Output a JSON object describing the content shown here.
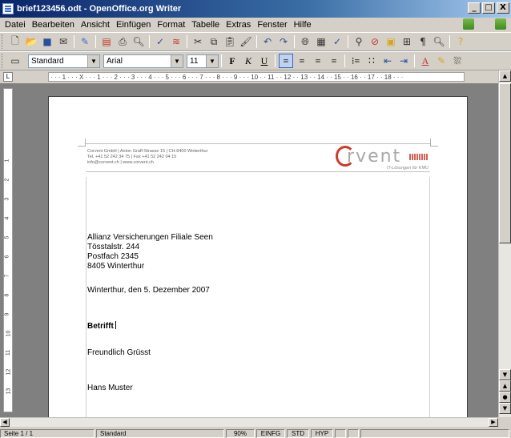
{
  "window": {
    "title": "brief123456.odt - OpenOffice.org Writer",
    "buttons": [
      "_",
      "□",
      "X"
    ]
  },
  "menu": [
    "Datei",
    "Bearbeiten",
    "Ansicht",
    "Einfügen",
    "Format",
    "Tabelle",
    "Extras",
    "Fenster",
    "Hilfe"
  ],
  "toolbar": {
    "paragraph_style": "Standard",
    "font_name": "Arial",
    "font_size": "11",
    "bold_label": "F",
    "italic_label": "K",
    "underline_label": "U"
  },
  "ruler": {
    "h_marks": "· · · 1 · · · X · · · 1 · · · 2 · · · 3 · · · 4 · · · 5 · · · 6 · · · 7 · · · 8 · · · 9 · · · 10 · · 11 · · 12 · · 13 · · 14 · · 15 · · 16 · · 17 · · 18 · · ·",
    "v_marks": [
      "1",
      "2",
      "3",
      "4",
      "5",
      "6",
      "7",
      "8",
      "9",
      "10",
      "11",
      "12",
      "13"
    ]
  },
  "document": {
    "header_line1": "Corvent GmbH | Anton Graff-Strasse 15 | CH-8400 Winterthur",
    "header_line2": "Tel. +41 52 242 34 75 | Fax +41 52 242 04 15",
    "header_line3": "info@corvent.ch | www.corvent.ch",
    "logo_word": "rvent",
    "logo_tagline": "IT-Lösungen für KMU",
    "recipient_line1": "Allianz Versicherungen Filiale Seen",
    "recipient_line2": "Tösstalstr. 244",
    "recipient_line3": "Postfach 2345",
    "recipient_line4": "8405 Winterthur",
    "date_line": "Winterthur, den 5. Dezember 2007",
    "subject": "Betrifft",
    "greeting": "Freundlich Grüsst",
    "signature": "Hans Muster"
  },
  "status": {
    "page": "Seite 1 / 1",
    "style": "Standard",
    "zoom": "90%",
    "insert_mode": "EINFG",
    "selection_mode": "STD",
    "hyperlink_mode": "HYP"
  },
  "colors": {
    "logo_accent": "#cc3a2a",
    "titlebar": "#0a246a"
  }
}
